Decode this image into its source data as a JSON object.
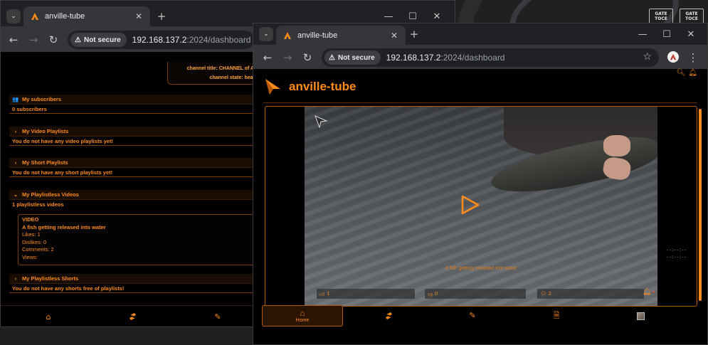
{
  "desktop": {
    "icons": [
      {
        "label": "GATE TOCE"
      },
      {
        "label": "GATE TOCE"
      }
    ]
  },
  "left_window": {
    "tab": {
      "title": "anville-tube",
      "close": "✕"
    },
    "new_tab": "+",
    "window_controls": {
      "minimize": "—",
      "maximize": "☐",
      "close": "✕"
    },
    "nav": {
      "back": "←",
      "forward": "→",
      "reload": "↻"
    },
    "omnibox": {
      "security_chip": "Not secure",
      "host": "192.168.137.2",
      "path": ":2024/dashboard"
    },
    "channel_card": {
      "title_line": "channel title: CHANNEL of AWS",
      "state_line": "channel state: healthy"
    },
    "sections": {
      "subscribers": {
        "header": "My subscribers",
        "value": "0 subscribers"
      },
      "video_playlists": {
        "header": "My Video Playlists",
        "value": "You do not have any video playlists yet!"
      },
      "short_playlists": {
        "header": "My Short Playlists",
        "value": "You do not have any short playlists yet!"
      },
      "playlistless_videos": {
        "header": "My Playlistless Videos",
        "value": "1 playlistless videos"
      },
      "playlistless_shorts": {
        "header": "My Playlistless Shorts",
        "value": "You do not have any shorts free of playlists!"
      }
    },
    "video_card": {
      "type": "VIDEO",
      "title": "A fish getting released into water",
      "likes": "Likes: 1",
      "dislikes": "Dislikes: 0",
      "comments": "Comments: 2",
      "views": "Views:"
    }
  },
  "right_window": {
    "tab": {
      "title": "anville-tube",
      "close": "✕"
    },
    "new_tab": "+",
    "window_controls": {
      "minimize": "—",
      "maximize": "☐",
      "close": "✕"
    },
    "nav": {
      "back": "←",
      "forward": "→",
      "reload": "↻"
    },
    "omnibox": {
      "security_chip": "Not secure",
      "host": "192.168.137.2",
      "path": ":2024/dashboard"
    },
    "toolbar_extras": {
      "bookmark": "☆",
      "menu": "⋮"
    },
    "brand": {
      "name": "anville-tube"
    },
    "player": {
      "caption": "A fish getting released into water",
      "likes": "1",
      "dislikes": "0",
      "comments": "2",
      "time_elapsed": "--:--:--",
      "time_total": "--:--:--"
    },
    "bottom_nav": {
      "home_label": "Home"
    }
  },
  "colors": {
    "accent": "#ff8c1a",
    "border": "#b45a08",
    "chrome_dark": "#202124",
    "chrome_toolbar": "#35363a"
  }
}
